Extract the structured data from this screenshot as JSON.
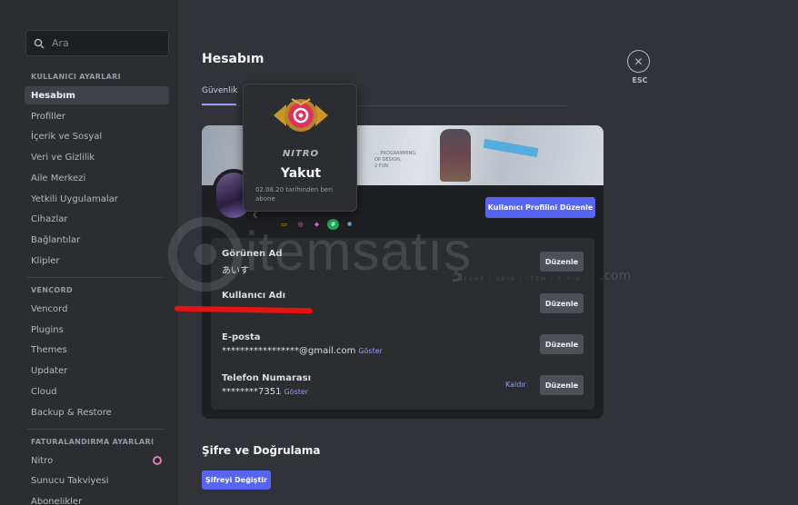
{
  "search": {
    "placeholder": "Ara"
  },
  "sidebar": {
    "sections": [
      {
        "header": "KULLANICI AYARLARI",
        "items": [
          "Hesabım",
          "Profiller",
          "İçerik ve Sosyal",
          "Veri ve Gizlilik",
          "Aile Merkezi",
          "Yetkili Uygulamalar",
          "Cihazlar",
          "Bağlantılar",
          "Klipler"
        ]
      },
      {
        "header": "VENCORD",
        "items": [
          "Vencord",
          "Plugins",
          "Themes",
          "Updater",
          "Cloud",
          "Backup & Restore"
        ]
      },
      {
        "header": "FATURALANDIRMA AYARLARI",
        "items": [
          "Nitro",
          "Sunucu Takviyesi",
          "Abonelikler"
        ]
      }
    ],
    "active_item": "Hesabım"
  },
  "main": {
    "title": "Hesabım",
    "tab": "Güvenlik",
    "edit_profile_button": "Kullanıcı Profilini Düzenle",
    "fields": [
      {
        "label": "Görünen Ad",
        "value": "あいす",
        "edit": "Düzenle"
      },
      {
        "label": "Kullanıcı Adı",
        "value": "",
        "edit": "Düzenle"
      },
      {
        "label": "E-posta",
        "value": "*****************@gmail.com",
        "show": "Göster",
        "edit": "Düzenle"
      },
      {
        "label": "Telefon Numarası",
        "value": "********7351",
        "show": "Göster",
        "remove": "Kaldır",
        "edit": "Düzenle"
      }
    ],
    "password_section_title": "Şifre ve Doğrulama",
    "change_password_button": "Şifreyi Değiştir"
  },
  "close": {
    "label": "ESC"
  },
  "tooltip": {
    "brand": "NITRO",
    "tier": "Yakut",
    "since": "02.08.20 tarihinden beri abone"
  },
  "banner_text": "... PROGRAMMING,\nOP DESIGN.\n2 FUN",
  "watermark": {
    "text": "itemsatış",
    "sub": "HESAP / SKIN / ITEM / E-PIN",
    "com": ".com"
  },
  "colors": {
    "accent": "#5865f2",
    "link": "#949cf7",
    "nitro_pink": "#e07cb6",
    "ruby": "#d9345a"
  }
}
